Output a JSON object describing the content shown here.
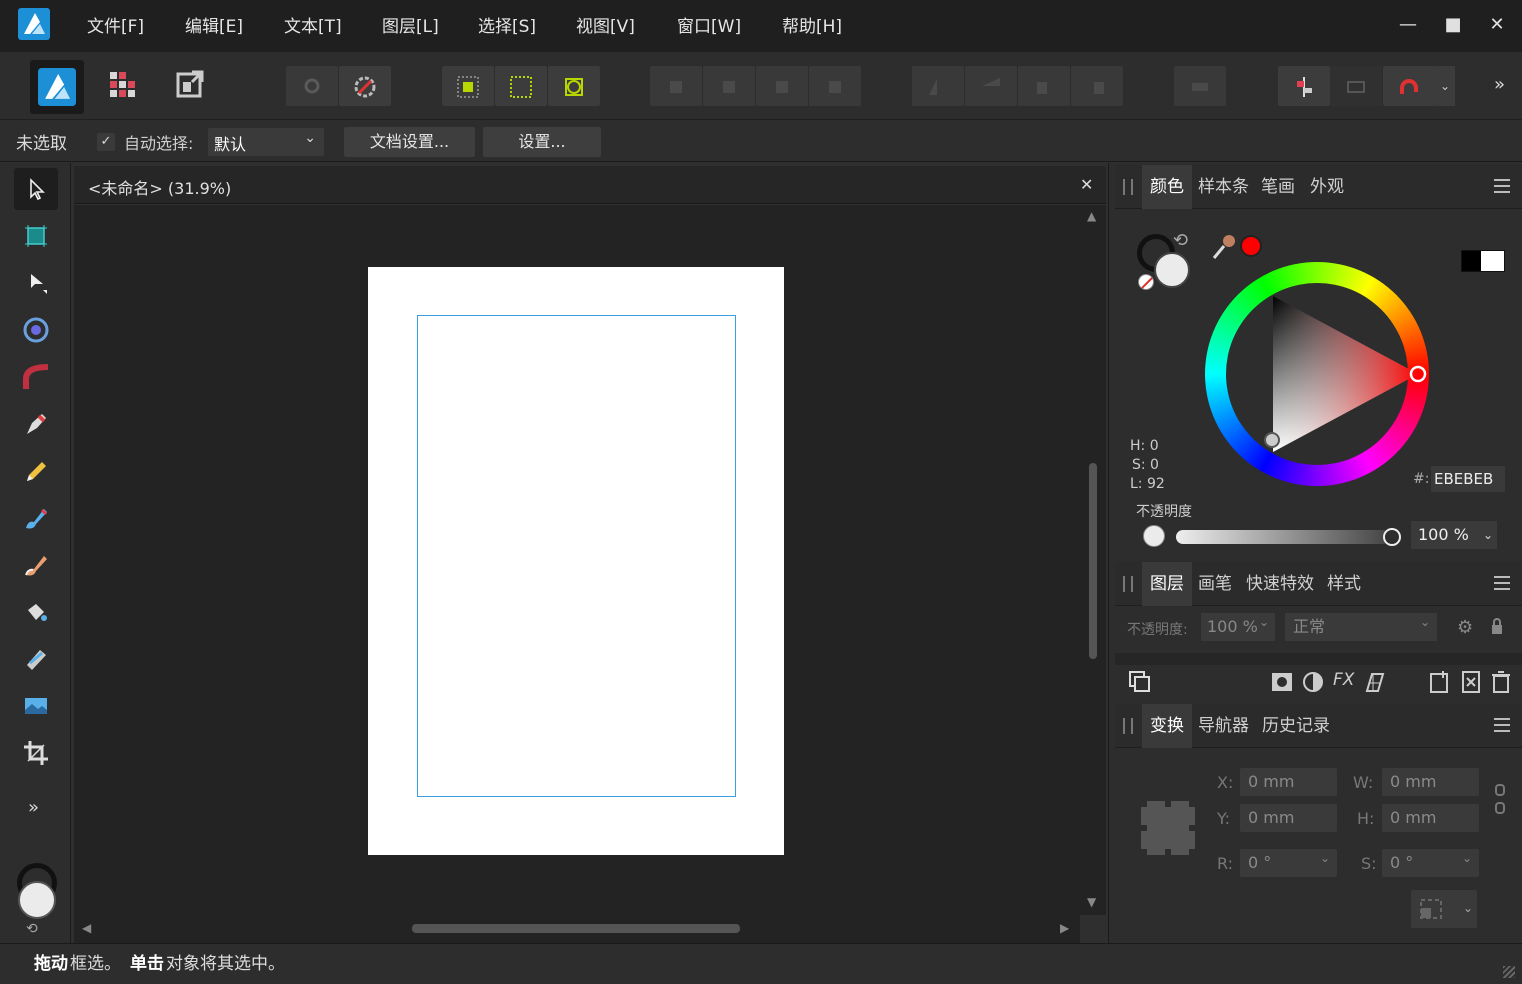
{
  "menu": [
    "文件[F]",
    "编辑[E]",
    "文本[T]",
    "图层[L]",
    "选择[S]",
    "视图[V]",
    "窗口[W]",
    "帮助[H]"
  ],
  "window": {
    "minimize": "—",
    "maximize": "■",
    "close": "✕"
  },
  "toolbar": {
    "overflow": "»"
  },
  "context": {
    "selection_label": "未选取",
    "auto_select_label": "自动选择:",
    "auto_select_value": "默认",
    "doc_setup_label": "文档设置...",
    "prefs_label": "设置..."
  },
  "document": {
    "tab_title": "<未命名> (31.9%)",
    "close": "✕"
  },
  "tools": [
    "move-tool-icon",
    "artboard-tool-icon",
    "node-tool-icon",
    "contour-tool-icon",
    "corner-tool-icon",
    "pen-tool-icon",
    "pencil-tool-icon",
    "vector-brush-icon",
    "paint-brush-icon",
    "fill-tool-icon",
    "transparency-tool-icon",
    "place-image-icon",
    "crop-tool-icon"
  ],
  "tools_more": "»",
  "color_panel": {
    "tabs": [
      "颜色",
      "样本条",
      "笔画",
      "外观"
    ],
    "h": "H: 0",
    "s": "S: 0",
    "l": "L: 92",
    "hex_label": "#:",
    "hex_value": "EBEBEB",
    "opacity_label": "不透明度",
    "opacity_value": "100 %",
    "accent": "#ff0000",
    "fill": "#ebebeb"
  },
  "layers_panel": {
    "tabs": [
      "图层",
      "画笔",
      "快速特效",
      "样式"
    ],
    "opacity_label": "不透明度:",
    "opacity_value": "100 %",
    "blend_mode": "正常"
  },
  "transform_panel": {
    "tabs": [
      "变换",
      "导航器",
      "历史记录"
    ],
    "x_label": "X:",
    "x_value": "0 mm",
    "y_label": "Y:",
    "y_value": "0 mm",
    "w_label": "W:",
    "w_value": "0 mm",
    "h_label": "H:",
    "h_value": "0 mm",
    "r_label": "R:",
    "r_value": "0 °",
    "s_label": "S:",
    "s_value": "0 °"
  },
  "status": {
    "drag_bold": "拖动",
    "drag_text": " 框选。",
    "click_bold": "单击",
    "click_text": " 对象将其选中。"
  },
  "colors": {
    "selection_blue": "#3b9ee0",
    "page": "#ffffff",
    "brand": "#1fa0e6"
  }
}
